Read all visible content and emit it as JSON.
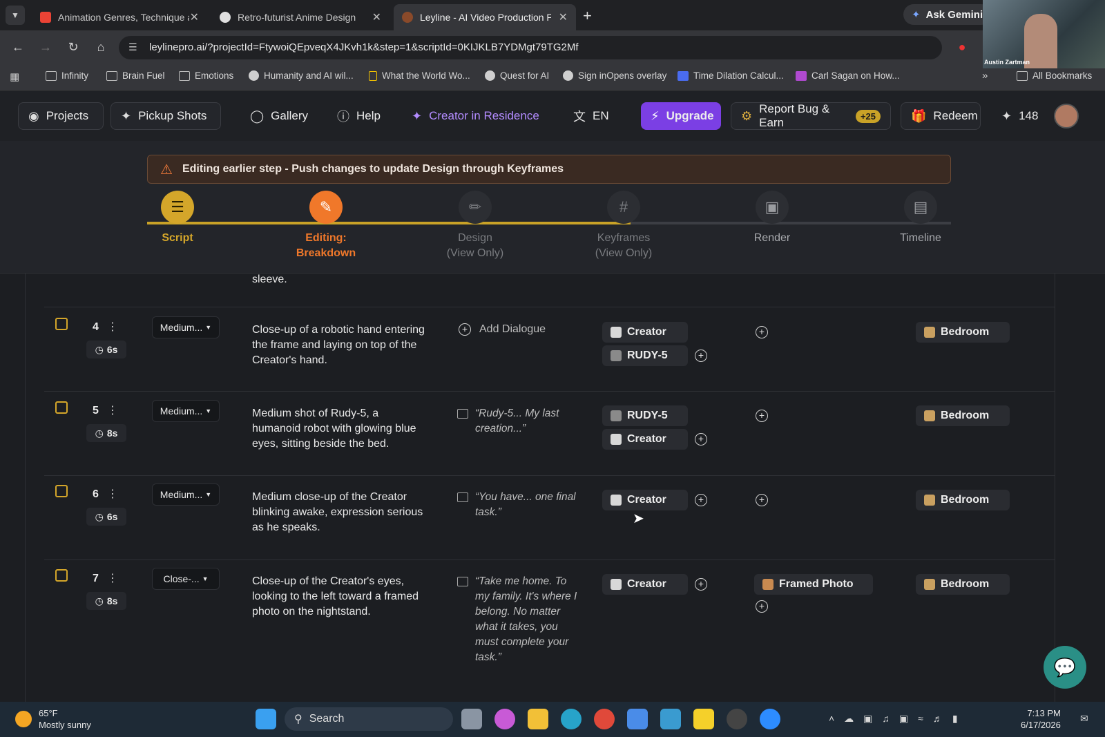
{
  "browser": {
    "tabs": [
      {
        "title": "Animation Genres, Technique an",
        "active": false
      },
      {
        "title": "Retro-futurist Anime Design",
        "active": false
      },
      {
        "title": "Leyline - AI Video Production P",
        "active": true
      }
    ],
    "url": "leylinepro.ai/?projectId=FtywoiQEpveqX4JKvh1k&step=1&scriptId=0KIJKLB7YDMgt79TG2Mf",
    "ask_gemini": "Ask Gemini",
    "bookmarks": [
      "Infinity",
      "Brain Fuel",
      "Emotions",
      "Humanity and AI wil...",
      "What the World Wo...",
      "Quest for AI",
      "Sign inOpens overlay",
      "Time Dilation Calcul...",
      "Carl Sagan on How..."
    ],
    "all_bookmarks": "All Bookmarks",
    "webcam_name": "Austin Zartman"
  },
  "header": {
    "projects": "Projects",
    "pickup_shots": "Pickup Shots",
    "gallery": "Gallery",
    "help": "Help",
    "creator_residence": "Creator in Residence",
    "language": "EN",
    "upgrade": "Upgrade",
    "report_bug": "Report Bug & Earn",
    "report_bug_badge": "+25",
    "redeem": "Redeem",
    "credits": "148"
  },
  "banner": {
    "text": "Editing earlier step - Push changes to update Design through Keyframes"
  },
  "steps": [
    {
      "line1": "Script",
      "line2": "",
      "state": "done"
    },
    {
      "line1": "Editing:",
      "line2": "Breakdown",
      "state": "current"
    },
    {
      "line1": "Design",
      "line2": "(View Only)",
      "state": "locked"
    },
    {
      "line1": "Keyframes",
      "line2": "(View Only)",
      "state": "locked"
    },
    {
      "line1": "Render",
      "line2": "",
      "state": "inactive"
    },
    {
      "line1": "Timeline",
      "line2": "",
      "state": "inactive"
    }
  ],
  "table": {
    "prev_tail": "sleeve.",
    "rows": [
      {
        "num": "4",
        "duration": "6s",
        "shot": "Medium...",
        "description": "Close-up of a robotic hand entering the frame and laying on top of the Creator's hand.",
        "dialogue": "",
        "add_dialogue": "Add Dialogue",
        "characters": [
          "Creator",
          "RUDY-5"
        ],
        "props": [],
        "location": "Bedroom"
      },
      {
        "num": "5",
        "duration": "8s",
        "shot": "Medium...",
        "description": "Medium shot of Rudy-5, a humanoid robot with glowing blue eyes, sitting beside the bed.",
        "dialogue": "“Rudy-5... My last creation...”",
        "characters": [
          "RUDY-5",
          "Creator"
        ],
        "props": [],
        "location": "Bedroom"
      },
      {
        "num": "6",
        "duration": "6s",
        "shot": "Medium...",
        "description": "Medium close-up of the Creator blinking awake, expression serious as he speaks.",
        "dialogue": "“You have... one final task.”",
        "characters": [
          "Creator"
        ],
        "props": [],
        "location": "Bedroom"
      },
      {
        "num": "7",
        "duration": "8s",
        "shot": "Close-...",
        "description": "Close-up of the Creator's eyes, looking to the left toward a framed photo on the nightstand.",
        "dialogue": "“Take me home. To my family. It's where I belong. No matter what it takes, you must complete your task.”",
        "characters": [
          "Creator"
        ],
        "props": [
          "Framed Photo"
        ],
        "location": "Bedroom"
      }
    ]
  },
  "taskbar": {
    "weather_temp": "65°F",
    "weather_desc": "Mostly sunny",
    "search": "Search",
    "time": "7:13 PM",
    "date": "6/17/2026"
  },
  "colors": {
    "accent_gold": "#c9a227",
    "accent_orange": "#f0782a",
    "upgrade_purple": "#7b3fe4",
    "creator_purple": "#b38cff"
  }
}
